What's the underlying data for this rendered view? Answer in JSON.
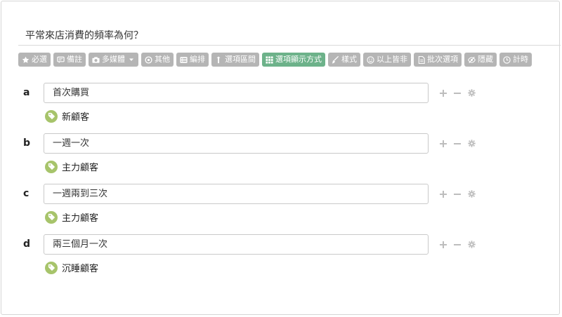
{
  "question": {
    "title": "平常來店消費的頻率為何？"
  },
  "toolbar": {
    "buttons": [
      {
        "label": "必選",
        "icon": "star-icon"
      },
      {
        "label": "備註",
        "icon": "comment-icon"
      },
      {
        "label": "多媒體",
        "icon": "camera-icon"
      },
      {
        "label": "其他",
        "icon": "circle-dot-icon"
      },
      {
        "label": "編排",
        "icon": "list-icon"
      },
      {
        "label": "選項區間",
        "icon": "sort-icon"
      },
      {
        "label": "選項顯示方式",
        "icon": "grid-icon",
        "active": true
      },
      {
        "label": "樣式",
        "icon": "brush-icon"
      },
      {
        "label": "以上皆非",
        "icon": "smile-icon"
      },
      {
        "label": "批次選項",
        "icon": "file-icon"
      },
      {
        "label": "隱藏",
        "icon": "eye-off-icon"
      },
      {
        "label": "計時",
        "icon": "clock-icon"
      }
    ]
  },
  "options": [
    {
      "letter": "a",
      "value": "首次購買",
      "tag": "新顧客"
    },
    {
      "letter": "b",
      "value": "一週一次",
      "tag": "主力顧客"
    },
    {
      "letter": "c",
      "value": "一週兩到三次",
      "tag": "主力顧客"
    },
    {
      "letter": "d",
      "value": "兩三個月一次",
      "tag": "沉睡顧客"
    }
  ],
  "colors": {
    "toolbar_button": "#b5b5b5",
    "toolbar_active": "#6db28a",
    "tag": "#a7c46b",
    "control": "#bdbdbd"
  }
}
